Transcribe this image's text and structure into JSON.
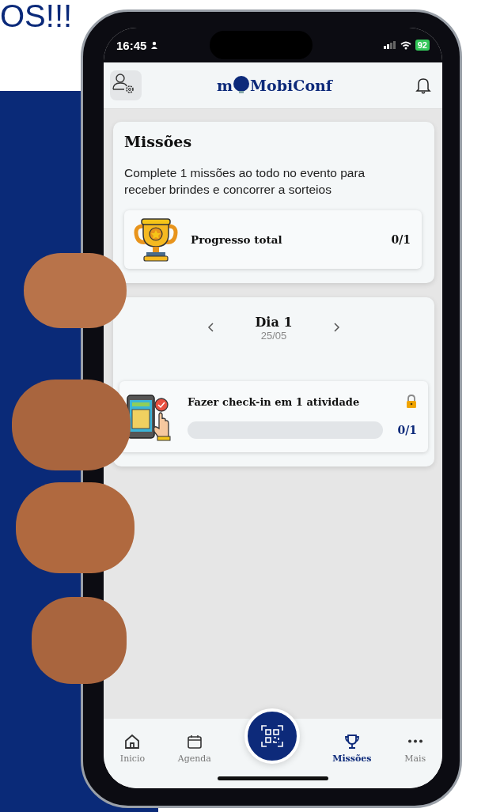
{
  "headline": "OS!!!",
  "status_bar": {
    "time": "16:45",
    "battery": "92"
  },
  "header": {
    "logo_prefix": "m",
    "logo": "MobiConf"
  },
  "missions_card": {
    "title": "Missões",
    "description": "Complete 1 missões ao todo no evento para receber brindes e concorrer a sorteios",
    "progress": {
      "label": "Progresso total",
      "value": "0/1"
    }
  },
  "day_card": {
    "day": "Dia 1",
    "date": "25/05",
    "missions": [
      {
        "title": "Fazer check-in em 1 atividade",
        "locked": true,
        "level": 0,
        "reading": "0/1"
      }
    ]
  },
  "nav": [
    {
      "kind": "home",
      "label": "Inicio",
      "selected": false
    },
    {
      "kind": "calendar",
      "label": "Agenda",
      "selected": false
    },
    {
      "kind": "qr"
    },
    {
      "kind": "trophy",
      "label": "Missões",
      "selected": true
    },
    {
      "kind": "more",
      "label": "Mais",
      "selected": false
    }
  ]
}
